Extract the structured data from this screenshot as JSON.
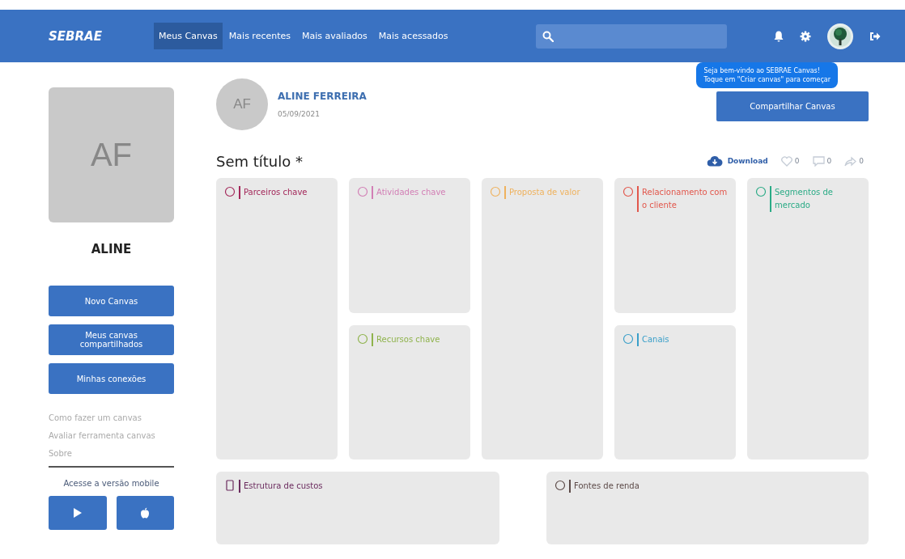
{
  "header": {
    "logo": "SEBRAE",
    "nav": [
      {
        "label": "Meus Canvas",
        "selected": true
      },
      {
        "label": "Mais recentes",
        "selected": false
      },
      {
        "label": "Mais avaliados",
        "selected": false
      },
      {
        "label": "Mais acessados",
        "selected": false
      }
    ]
  },
  "sidebar": {
    "avatar_initials": "AF",
    "name": "ALINE",
    "buttons": [
      "Novo Canvas",
      "Meus canvas compartilhados",
      "Minhas conexões"
    ],
    "links": [
      "Como fazer um canvas",
      "Avaliar ferramenta canvas",
      "Sobre"
    ],
    "mobile_label": "Acesse a versão mobile"
  },
  "author": {
    "initials": "AF",
    "name": "ALINE FERREIRA",
    "date": "05/09/2021"
  },
  "tooltip": {
    "lines": [
      "Seja bem-vindo ao SEBRAE Canvas!",
      "Toque em \"Criar canvas\" para começar"
    ]
  },
  "share_button": "Compartilhar Canvas",
  "canvas": {
    "title": "Sem título *",
    "download": "Download",
    "likes": "0",
    "comments": "0",
    "shares": "0",
    "blocks": [
      {
        "title": "Parceiros chave",
        "color": "#a3285a"
      },
      {
        "title": "Atividades chave",
        "color": "#d27fb5"
      },
      {
        "title": "Recursos chave",
        "color": "#8fb34c"
      },
      {
        "title": "Proposta de valor",
        "color": "#efb25e"
      },
      {
        "title": "Relacionamento com o cliente",
        "color": "#e2574c"
      },
      {
        "title": "Canais",
        "color": "#3a9fc9"
      },
      {
        "title": "Segmentos de mercado",
        "color": "#2bab86"
      },
      {
        "title": "Estrutura de custos",
        "color": "#6b2b5e"
      },
      {
        "title": "Fontes de renda",
        "color": "#5c4a48"
      }
    ]
  }
}
